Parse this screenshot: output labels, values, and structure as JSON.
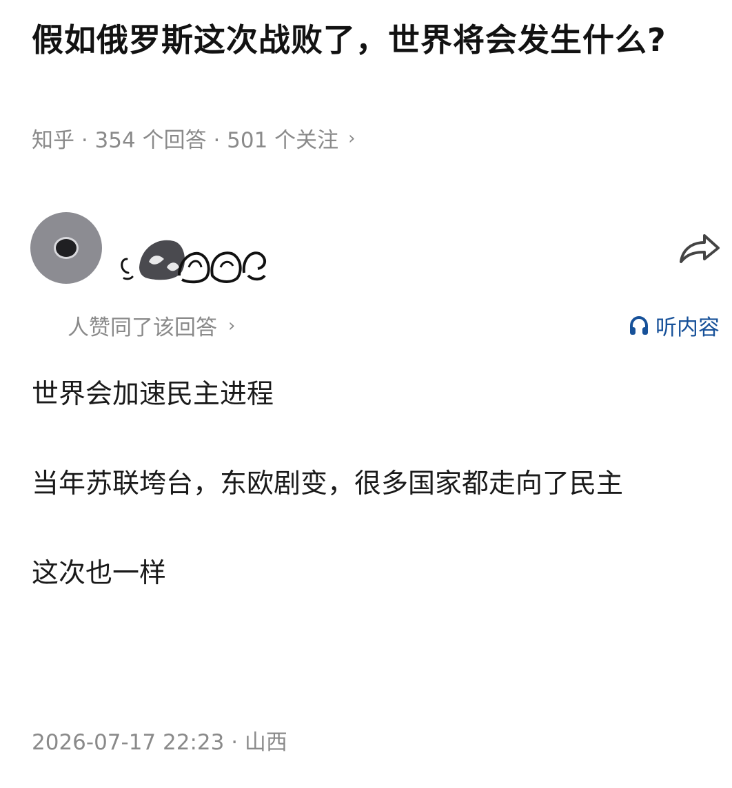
{
  "question": {
    "title": "假如俄罗斯这次战败了，世界将会发生什么?",
    "meta": "知乎 · 354 个回答 · 501 个关注",
    "meta_chevron": "›"
  },
  "author": {
    "avatar_icon": "avatar-placeholder",
    "name_style": "scribbled-out"
  },
  "actions": {
    "share_icon": "share-arrow-icon",
    "listen_label": "听内容",
    "listen_icon": "headphones-icon",
    "accent_color": "#175199"
  },
  "upvote": {
    "text": "人赞同了该回答",
    "chevron": "›"
  },
  "answer": {
    "paragraphs": [
      "世界会加速民主进程",
      "当年苏联垮台，东欧剧变，很多国家都走向了民主",
      "这次也一样"
    ]
  },
  "footer": {
    "timestamp_location": "2026-07-17 22:23 · 山西"
  }
}
